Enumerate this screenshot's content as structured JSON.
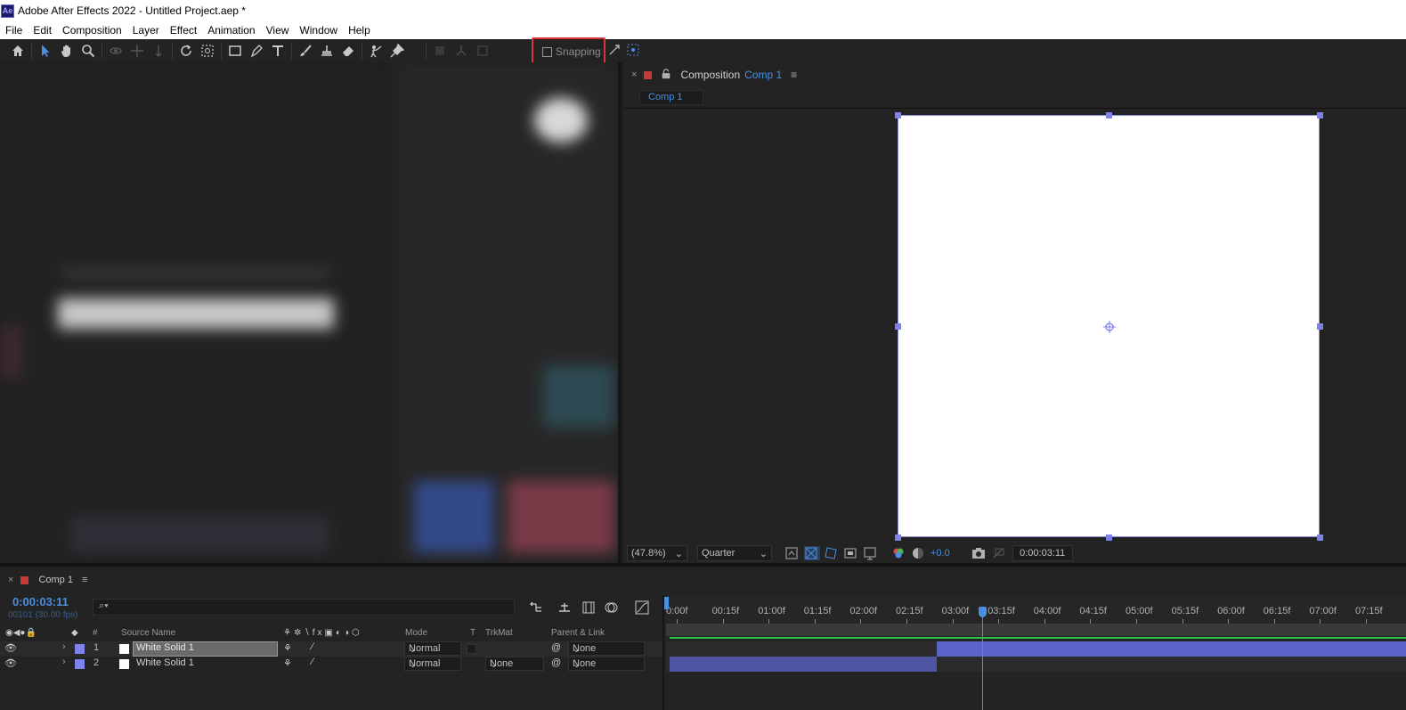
{
  "app": {
    "title": "Adobe After Effects 2022 - Untitled Project.aep *",
    "logo_text": "Ae"
  },
  "menu": [
    "File",
    "Edit",
    "Composition",
    "Layer",
    "Effect",
    "Animation",
    "View",
    "Window",
    "Help"
  ],
  "toolbar": {
    "snapping_label": "Snapping",
    "snapping_checked": false,
    "highlight_color": "#e0303a"
  },
  "composition": {
    "panel_label": "Composition",
    "comp_name": "Comp 1",
    "tab_label": "Comp 1",
    "zoom": "(47.8%)",
    "resolution": "Quarter",
    "exposure": "+0.0",
    "timecode": "0:00:03:11",
    "canvas_color": "#ffffff",
    "accent_color": "#4a8fe0"
  },
  "timeline": {
    "tab_label": "Comp 1",
    "current_time": "0:00:03:11",
    "frame_info": "00101 (30.00 fps)",
    "columns": {
      "number": "#",
      "source_name": "Source Name",
      "mode": "Mode",
      "t": "T",
      "trkmat": "TrkMat",
      "parent": "Parent & Link"
    },
    "ruler_ticks": [
      "0:00f",
      "00:15f",
      "01:00f",
      "01:15f",
      "02:00f",
      "02:15f",
      "03:00f",
      "03:15f",
      "04:00f",
      "04:15f",
      "05:00f",
      "05:15f",
      "06:00f",
      "06:15f",
      "07:00f",
      "07:15f"
    ],
    "playhead": "0:00:03:11",
    "layers": [
      {
        "number": "1",
        "name": "White Solid 1",
        "mode": "Normal",
        "trkmat": "",
        "parent": "None",
        "in_sec": 2.87,
        "selected": true
      },
      {
        "number": "2",
        "name": "White Solid 1",
        "mode": "Normal",
        "trkmat": "None",
        "parent": "None",
        "out_sec": 2.87,
        "selected": false
      }
    ]
  }
}
